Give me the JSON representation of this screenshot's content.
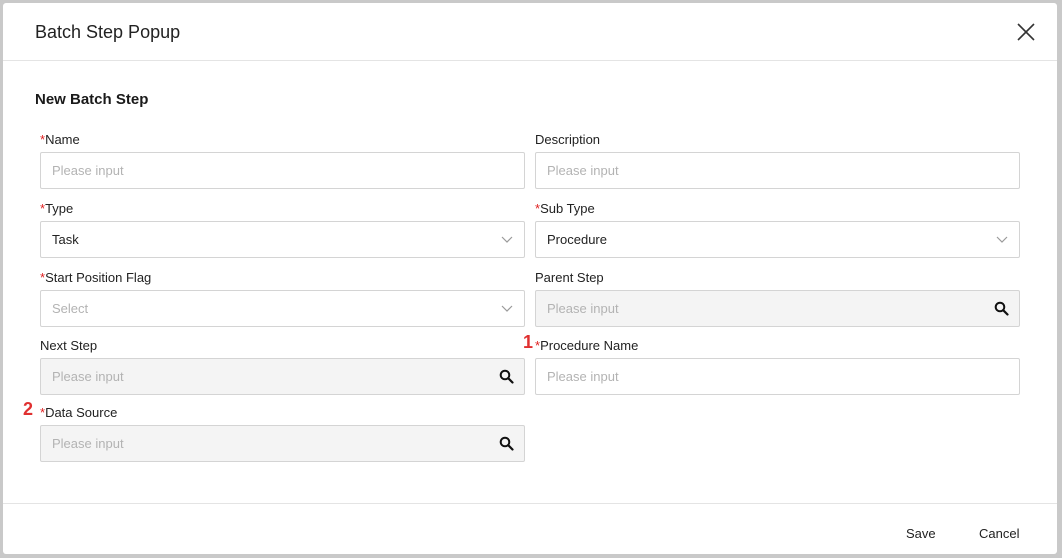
{
  "modal": {
    "title": "Batch Step Popup",
    "section_title": "New Batch Step"
  },
  "fields": {
    "name": {
      "label": "Name",
      "required": "*",
      "placeholder": "Please input"
    },
    "description": {
      "label": "Description",
      "placeholder": "Please input"
    },
    "type": {
      "label": "Type",
      "required": "*",
      "value": "Task"
    },
    "sub_type": {
      "label": "Sub Type",
      "required": "*",
      "value": "Procedure"
    },
    "start_position_flag": {
      "label": "Start Position Flag",
      "required": "*",
      "placeholder": "Select"
    },
    "parent_step": {
      "label": "Parent Step",
      "placeholder": "Please input"
    },
    "next_step": {
      "label": "Next Step",
      "placeholder": "Please input"
    },
    "procedure_name": {
      "label": "Procedure Name",
      "required": "*",
      "placeholder": "Please input",
      "marker": "1"
    },
    "data_source": {
      "label": "Data Source",
      "required": "*",
      "placeholder": "Please input",
      "marker": "2"
    }
  },
  "footer": {
    "save_label": "Save",
    "cancel_label": "Cancel"
  },
  "icons": {
    "close": "close-icon",
    "dropdown": "chevron-down-icon",
    "search": "search-icon"
  },
  "colors": {
    "required": "#e02020",
    "marker": "#e03030",
    "disabled_bg": "#f4f4f4",
    "border": "#d4d4d4"
  }
}
